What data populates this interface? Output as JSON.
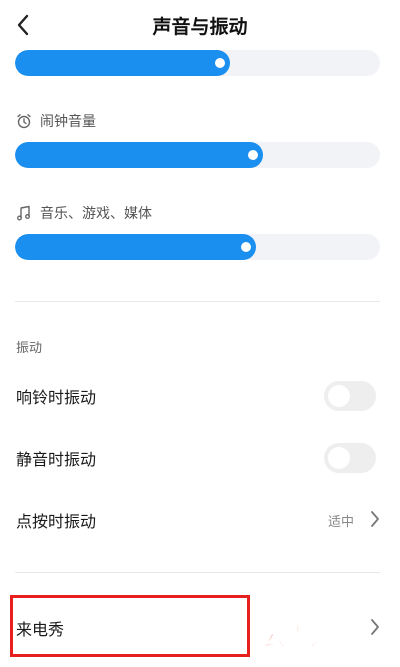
{
  "header": {
    "title": "声音与振动",
    "back_icon": "chevron-left-icon"
  },
  "volume": {
    "ringtone": {
      "level": 0.59
    },
    "alarm": {
      "label": "闹钟音量",
      "icon": "alarm-clock-icon",
      "level": 0.68
    },
    "media": {
      "label": "音乐、游戏、媒体",
      "icon": "music-note-icon",
      "level": 0.66
    }
  },
  "vibration": {
    "section_title": "振动",
    "ring_vibrate": {
      "label": "响铃时振动",
      "on": false
    },
    "silent_vibrate": {
      "label": "静音时振动",
      "on": false
    },
    "touch_vibrate": {
      "label": "点按时振动",
      "value": "适中"
    }
  },
  "caller_show": {
    "label": "来电秀"
  },
  "watermark": {
    "text": "云南龙网"
  },
  "colors": {
    "accent": "#1a8ff0",
    "track": "#f1f3f6",
    "highlight": "#e8201d",
    "watermark": "#e8301d"
  }
}
